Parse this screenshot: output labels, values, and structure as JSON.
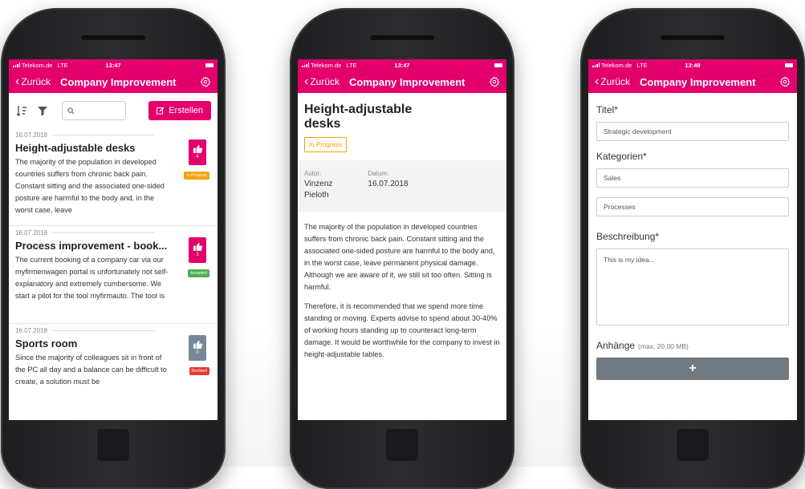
{
  "status": {
    "carrier": "Telekom.de",
    "network": "LTE",
    "time1": "13:47",
    "time2": "13:47",
    "time3": "13:49"
  },
  "nav": {
    "back": "Zurück",
    "title": "Company Improvement"
  },
  "list": {
    "create_label": "Erstellen",
    "items": [
      {
        "date": "16.07.2018",
        "title": "Height-adjustable desks",
        "text": "The majority of the population in developed countries suffers from chronic back pain. Constant sitting and the associated one-sided posture are harmful to the body and, in the worst case, leave",
        "votes": "4",
        "status": "In Progress",
        "status_color": "#f5a300"
      },
      {
        "date": "16.07.2018",
        "title": "Process improvement - book...",
        "text": "The current booking of a company car via our myfirmenwagen portal is unfortunately not self-explanatory and extremely cumbersome. We start a pilot for the tool myfirmauto. The tool is",
        "votes": "3",
        "status": "Accepted",
        "status_color": "#4caf50"
      },
      {
        "date": "16.07.2018",
        "title": "Sports room",
        "text": "Since the majority of colleagues sit in front of the PC all day and a balance can be difficult to create, a solution must be",
        "votes": "0",
        "status": "Declined",
        "status_color": "#e53935"
      }
    ]
  },
  "detail": {
    "title": "Height-adjustable desks",
    "status": "In Progress",
    "author_label": "Autor:",
    "author": "Vinzenz\nPieloth",
    "date_label": "Datum:",
    "date": "16.07.2018",
    "para1": "The majority of the population in developed countries suffers from chronic back pain. Constant sitting and the associated one-sided posture are harmful to the body and, in the worst case, leave permanent physical damage. Although we are aware of it, we still sit too often. Sitting is harmful.",
    "para2": "Therefore, it is recommended that we spend more time standing or moving. Experts advise to spend about 30-40% of working hours standing up to counteract long-term damage. It would be worthwhile for the company to invest in height-adjustable tables."
  },
  "form": {
    "title_label": "Titel*",
    "title_value": "Strategic development",
    "categories_label": "Kategorien*",
    "category1": "Sales",
    "category2": "Processes",
    "description_label": "Beschreibung*",
    "description_value": "This is my idea...",
    "attachments_label": "Anhänge",
    "attachments_max": "(max: 20.00 MB)",
    "add_label": "+"
  },
  "colors": {
    "brand": "#e3006d",
    "inprogress": "#f5a300",
    "accepted": "#4caf50",
    "declined": "#e53935",
    "grey_vote": "#778899"
  }
}
